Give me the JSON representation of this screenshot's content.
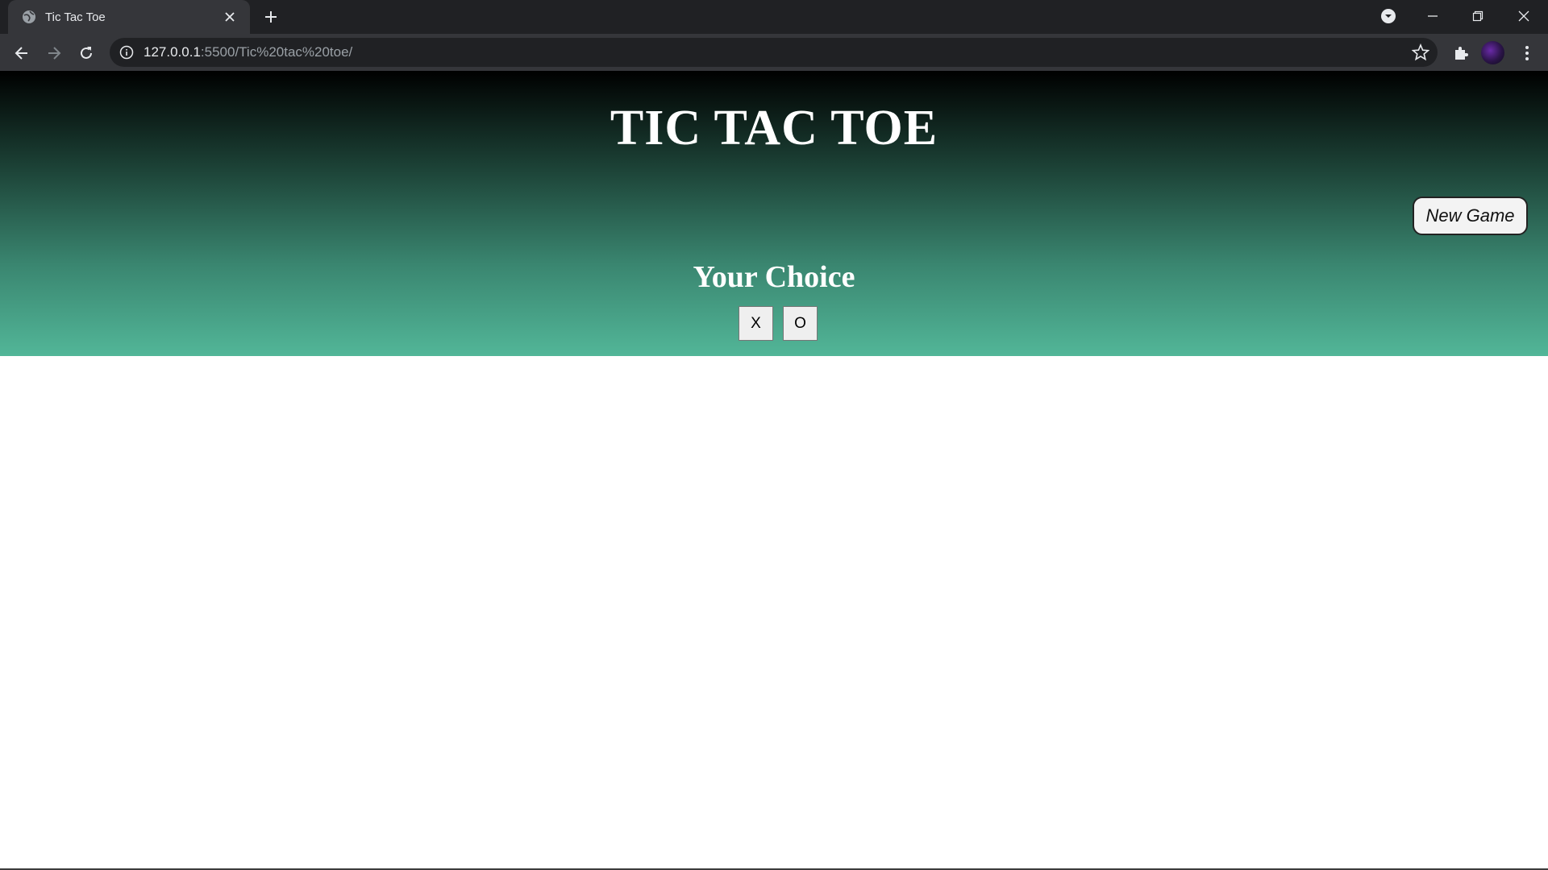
{
  "browser": {
    "tab_title": "Tic Tac Toe",
    "url_host": "127.0.0.1",
    "url_rest": ":5500/Tic%20tac%20toe/",
    "icons": [
      "globe-icon",
      "close-icon",
      "plus-icon",
      "tab-search-icon",
      "minimize-icon",
      "restore-icon",
      "window-close-icon",
      "back-arrow-icon",
      "forward-arrow-icon",
      "reload-icon",
      "info-icon",
      "star-icon",
      "puzzle-icon",
      "kebab-menu-icon"
    ]
  },
  "game": {
    "title": "TIC TAC TOE",
    "new_game_label": "New Game",
    "choice_heading": "Your Choice",
    "choices": [
      "X",
      "O"
    ]
  },
  "colors": {
    "banner_top": "#000000",
    "banner_bottom": "#52b698",
    "chrome_dark": "#202124",
    "chrome_toolbar": "#35363a"
  }
}
